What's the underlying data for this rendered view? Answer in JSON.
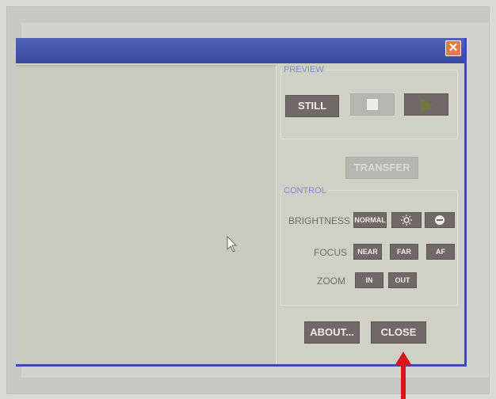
{
  "window": {
    "close_symbol": "✕"
  },
  "preview": {
    "title": "PREVIEW",
    "still_label": "STILL",
    "transfer_label": "TRANSFER"
  },
  "control": {
    "title": "CONTROL",
    "brightness_label": "BRIGHTNESS",
    "brightness_normal": "NORMAL",
    "focus_label": "FOCUS",
    "focus_near": "NEAR",
    "focus_far": "FAR",
    "focus_af": "AF",
    "zoom_label": "ZOOM",
    "zoom_in": "IN",
    "zoom_out": "OUT"
  },
  "footer": {
    "about_label": "ABOUT...",
    "close_label": "CLOSE"
  },
  "colors": {
    "titlebar": "#3d4ca2",
    "button": "#6f6968",
    "play_icon": "#6e7c34",
    "annotation_arrow": "#d9161a"
  },
  "icons": [
    "close-icon",
    "stop-icon",
    "play-icon",
    "brightness-sun-icon",
    "brightness-minus-icon",
    "mouse-pointer-icon",
    "red-arrow-icon"
  ]
}
